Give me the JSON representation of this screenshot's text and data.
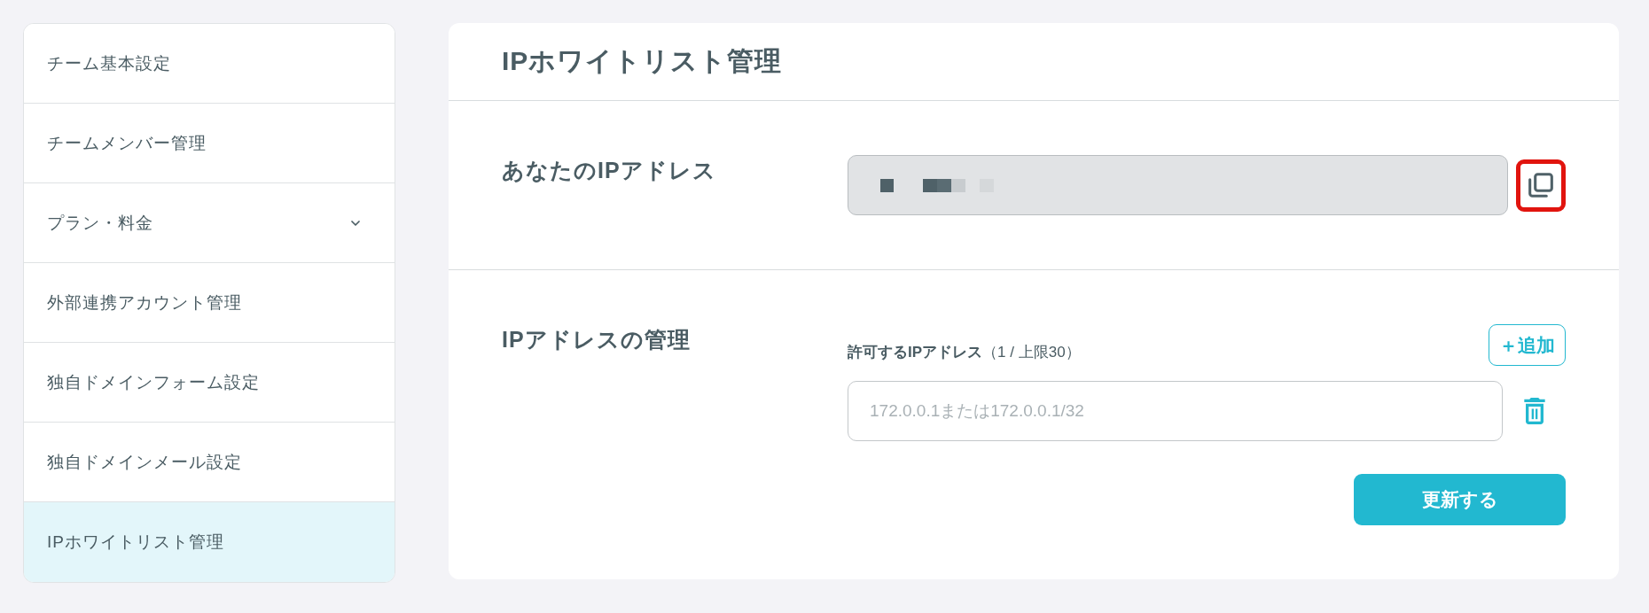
{
  "sidebar": {
    "items": [
      {
        "label": "チーム基本設定",
        "kind": "link",
        "selected": false
      },
      {
        "label": "チームメンバー管理",
        "kind": "link",
        "selected": false
      },
      {
        "label": "プラン・料金",
        "kind": "group",
        "expanded": false,
        "selected": false
      },
      {
        "label": "外部連携アカウント管理",
        "kind": "link",
        "selected": false
      },
      {
        "label": "独自ドメインフォーム設定",
        "kind": "link",
        "selected": false
      },
      {
        "label": "独自ドメインメール設定",
        "kind": "link",
        "selected": false
      },
      {
        "label": "IPホワイトリスト管理",
        "kind": "link",
        "selected": true
      }
    ]
  },
  "page": {
    "title": "IPホワイトリスト管理"
  },
  "your_ip": {
    "label": "あなたのIPアドレス",
    "highlighted": true
  },
  "ip_management": {
    "label": "IPアドレスの管理",
    "list_label": "**許可するIPアドレス**（1 / 上限30）",
    "add_button": "＋追加",
    "entries": [
      {
        "placeholder": "172.0.0.1または172.0.0.1/32"
      }
    ],
    "submit_button": "更新する"
  }
}
